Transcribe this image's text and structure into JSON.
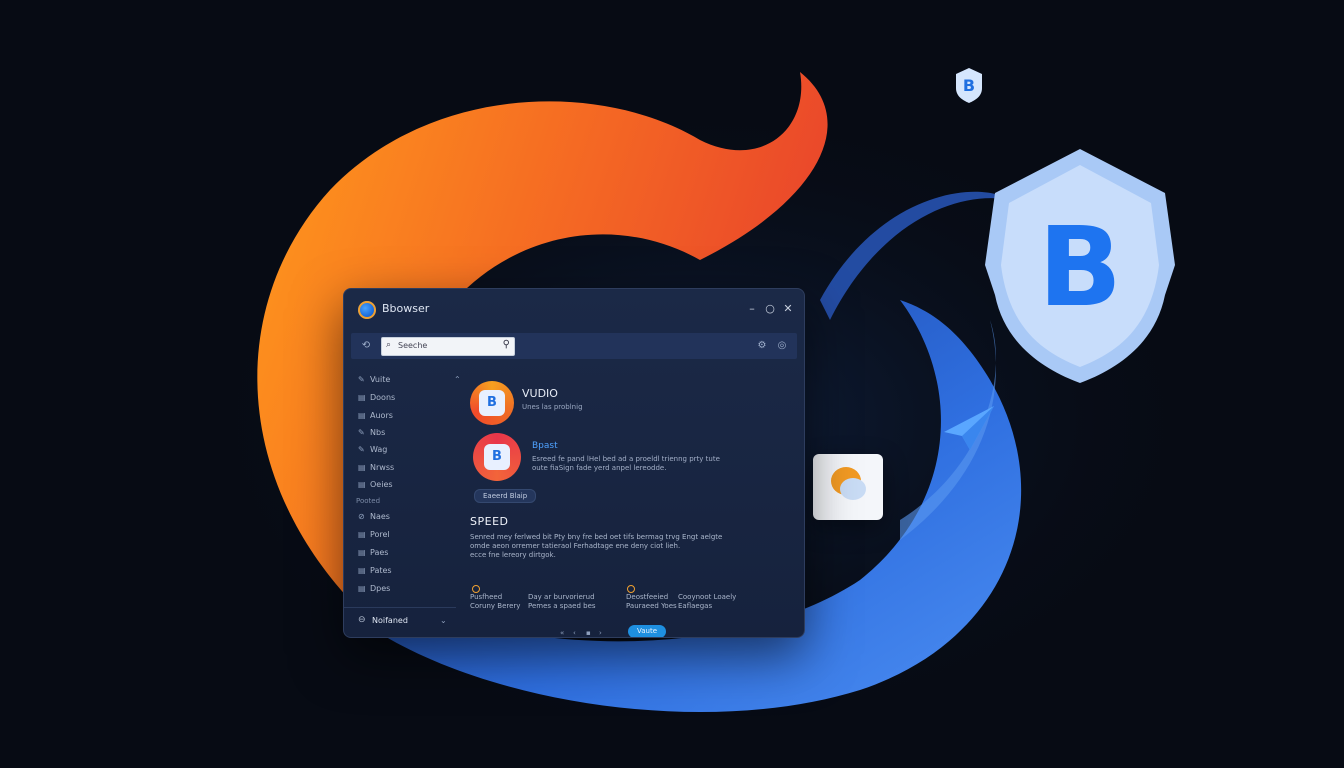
{
  "app": {
    "title": "Bbowser",
    "window_controls": {
      "minimize": "–",
      "maximize": "○",
      "close": "✕"
    }
  },
  "toolbar": {
    "back_icon": "back-icon",
    "search_placeholder": "Seeche",
    "right_icons": [
      "settings-icon",
      "globe-icon"
    ]
  },
  "sidebar": {
    "items": [
      {
        "icon": "pen-icon",
        "glyph": "✎",
        "label": "Vuite"
      },
      {
        "icon": "doc-icon",
        "glyph": "▤",
        "label": "Doons"
      },
      {
        "icon": "doc-icon",
        "glyph": "▤",
        "label": "Auors"
      },
      {
        "icon": "pen-icon",
        "glyph": "✎",
        "label": "Nbs"
      },
      {
        "icon": "pen-icon",
        "glyph": "✎",
        "label": "Wag"
      },
      {
        "icon": "doc-icon",
        "glyph": "▤",
        "label": "Nrwss"
      },
      {
        "icon": "doc-icon",
        "glyph": "▤",
        "label": "Oeies"
      }
    ],
    "section_label": "Pooted",
    "section_items": [
      {
        "icon": "link-icon",
        "glyph": "⊘",
        "label": "Naes"
      },
      {
        "icon": "doc-icon",
        "glyph": "▤",
        "label": "Porel"
      },
      {
        "icon": "doc-icon",
        "glyph": "▤",
        "label": "Paes"
      },
      {
        "icon": "doc-icon",
        "glyph": "▤",
        "label": "Pates"
      },
      {
        "icon": "doc-icon",
        "glyph": "▤",
        "label": "Dpes"
      }
    ],
    "footer_label": "Noifaned"
  },
  "main": {
    "item1": {
      "title": "VUDIO",
      "subtitle": "Unes las problnig"
    },
    "item2": {
      "title": "Bpast",
      "desc_line1": "Esreed fe pand lHel bed ad a proeldl trienng prty tute",
      "desc_line2": "oute fiaSign fade yerd anpel lereodde."
    },
    "pill_label": "Eaeerd Blaip",
    "speed": {
      "title": "SPEED",
      "line1": "Senred mey ferlwed bit Pty bny fre bed oet tifs bermag trvg Engt aelgte",
      "line2": "omde aeon orremer tatieraol Ferhadtage ene deny ciot lieh.",
      "line3": "ecce fne lereory dirtgok."
    },
    "stats": [
      {
        "line1": "Pusfheed",
        "line2": "Coruny Berery"
      },
      {
        "line1": "Day ar burvorierud",
        "line2": "Pemes a spaed bes"
      },
      {
        "line1": "Deostfeeied",
        "line2": "Pauraeed Yoes"
      },
      {
        "line1": "Cooynoot Loaely",
        "line2": "Eaflaegas"
      }
    ],
    "pager": [
      "«",
      "‹",
      "▪",
      "›"
    ],
    "action_label": "Vaute"
  },
  "floating": {
    "small_shield_letter": "B",
    "big_shield_letter": "B"
  },
  "colors": {
    "background": "#070b14",
    "orange": "#f08a1f",
    "blue": "#2f6fe0",
    "shield": "#bcd6fb"
  }
}
